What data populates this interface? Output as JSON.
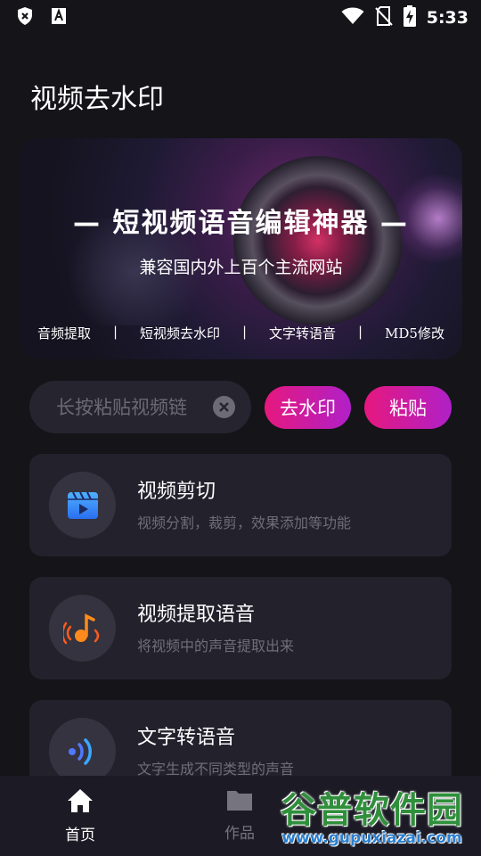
{
  "status_bar": {
    "time": "5:33",
    "left_icons": [
      "shield-x-icon",
      "font-a-icon"
    ],
    "right_icons": [
      "wifi-icon",
      "no-sim-icon",
      "battery-charging-icon"
    ]
  },
  "header": {
    "title": "视频去水印"
  },
  "banner": {
    "title": "— 短视频语音编辑神器 —",
    "subtitle": "兼容国内外上百个主流网站",
    "tags": [
      "音频提取",
      "|",
      "短视频去水印",
      "|",
      "文字转语音",
      "|",
      "MD5修改"
    ]
  },
  "search": {
    "placeholder": "长按粘贴视频链",
    "value": "",
    "clear_icon": "clear-icon"
  },
  "actions": {
    "remove_watermark": "去水印",
    "paste": "粘贴",
    "accent_start": "#e6187e",
    "accent_end": "#b020c8"
  },
  "features": [
    {
      "title": "视频剪切",
      "desc": "视频分割，裁剪，效果添加等功能",
      "icon": "clapperboard-play-icon"
    },
    {
      "title": "视频提取语音",
      "desc": "将视频中的声音提取出来",
      "icon": "music-note-icon"
    },
    {
      "title": "文字转语音",
      "desc": "文字生成不同类型的声音",
      "icon": "sound-wave-icon"
    }
  ],
  "bottom_nav": [
    {
      "label": "首页",
      "icon": "home-icon",
      "active": true
    },
    {
      "label": "作品",
      "icon": "folder-icon",
      "active": false
    }
  ],
  "watermark": {
    "text": "谷普软件园",
    "url": "www.gupuxiazai.com"
  }
}
